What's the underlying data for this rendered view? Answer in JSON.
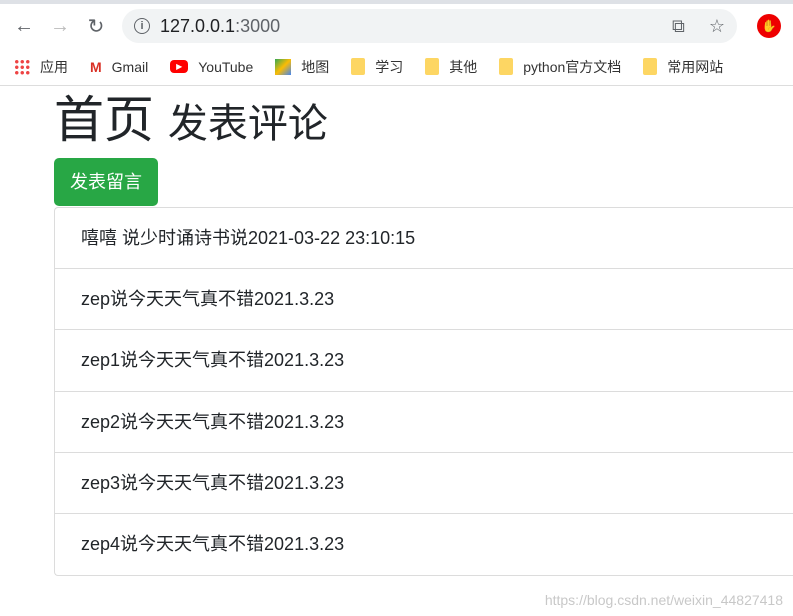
{
  "browser": {
    "url_host": "127.0.0.1",
    "url_port": ":3000",
    "bookmarks": [
      {
        "label": "应用",
        "icon": "apps-icon"
      },
      {
        "label": "Gmail",
        "icon": "gmail-icon"
      },
      {
        "label": "YouTube",
        "icon": "youtube-icon"
      },
      {
        "label": "地图",
        "icon": "maps-icon"
      },
      {
        "label": "学习",
        "icon": "folder-icon"
      },
      {
        "label": "其他",
        "icon": "folder-icon"
      },
      {
        "label": "python官方文档",
        "icon": "folder-icon"
      },
      {
        "label": "常用网站",
        "icon": "folder-icon"
      }
    ]
  },
  "page": {
    "title": "首页",
    "subtitle": "发表评论",
    "button": "发表留言",
    "button_color": "#28a745",
    "comments": [
      "嘻嘻 说少时诵诗书说2021-03-22 23:10:15",
      "zep说今天天气真不错2021.3.23",
      "zep1说今天天气真不错2021.3.23",
      "zep2说今天天气真不错2021.3.23",
      "zep3说今天天气真不错2021.3.23",
      "zep4说今天天气真不错2021.3.23"
    ]
  },
  "watermark": "https://blog.csdn.net/weixin_44827418"
}
